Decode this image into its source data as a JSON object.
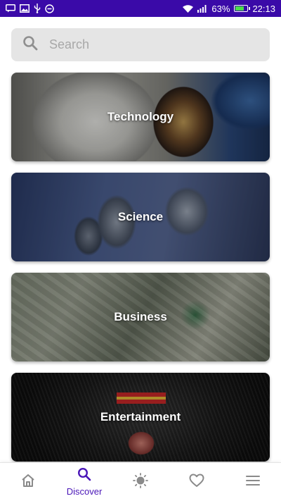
{
  "status_bar": {
    "battery_percent": "63%",
    "battery_level": 0.63,
    "time": "22:13",
    "background_color": "#3a0aa8",
    "left_icons": [
      "message-icon",
      "image-icon",
      "usb-icon",
      "circle-icon"
    ],
    "right_icons": [
      "wifi-icon",
      "signal-icon",
      "battery-icon"
    ]
  },
  "search": {
    "placeholder": "Search",
    "value": "",
    "icon": "search-icon"
  },
  "categories": [
    {
      "label": "Technology"
    },
    {
      "label": "Science"
    },
    {
      "label": "Business"
    },
    {
      "label": "Entertainment"
    }
  ],
  "bottom_nav": {
    "active_color": "#4a16b8",
    "items": [
      {
        "icon": "home-icon",
        "label": ""
      },
      {
        "icon": "search-icon",
        "label": "Discover"
      },
      {
        "icon": "sun-icon",
        "label": ""
      },
      {
        "icon": "heart-icon",
        "label": ""
      },
      {
        "icon": "menu-icon",
        "label": ""
      }
    ]
  }
}
